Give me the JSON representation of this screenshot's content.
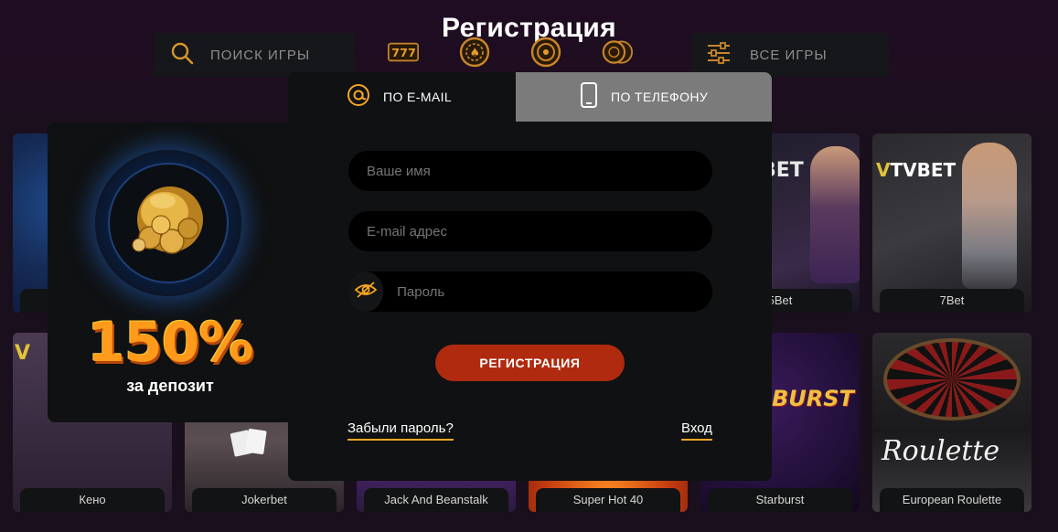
{
  "header": {
    "title": "Регистрация"
  },
  "topbar": {
    "search_label": "ПОИСК ИГРЫ",
    "all_games_label": "ВСЕ ИГРЫ",
    "category_icons": [
      "slots-777-icon",
      "poker-chip-icon",
      "roulette-icon",
      "chips-icon"
    ]
  },
  "games": {
    "row1": [
      "",
      "",
      "",
      "",
      "5Bet",
      "7Bet"
    ],
    "row2": [
      "Кено",
      "Jokerbet",
      "Jack And Beanstalk",
      "Super Hot 40",
      "Starburst",
      "European Roulette"
    ]
  },
  "promo": {
    "value": "150%",
    "caption": "за депозит"
  },
  "modal": {
    "tab_email": "ПО E-MAIL",
    "tab_phone": "ПО ТЕЛЕФОНУ",
    "name_placeholder": "Ваше имя",
    "email_placeholder": "E-mail адрес",
    "password_placeholder": "Пароль",
    "submit_label": "РЕГИСТРАЦИЯ",
    "forgot_link": "Забыли пароль?",
    "login_link": "Вход"
  },
  "colors": {
    "accent": "#f5a623",
    "submit": "#b02a0f",
    "tab_inactive": "#7b7b7b",
    "promo_orange": "#ff9a1a"
  }
}
